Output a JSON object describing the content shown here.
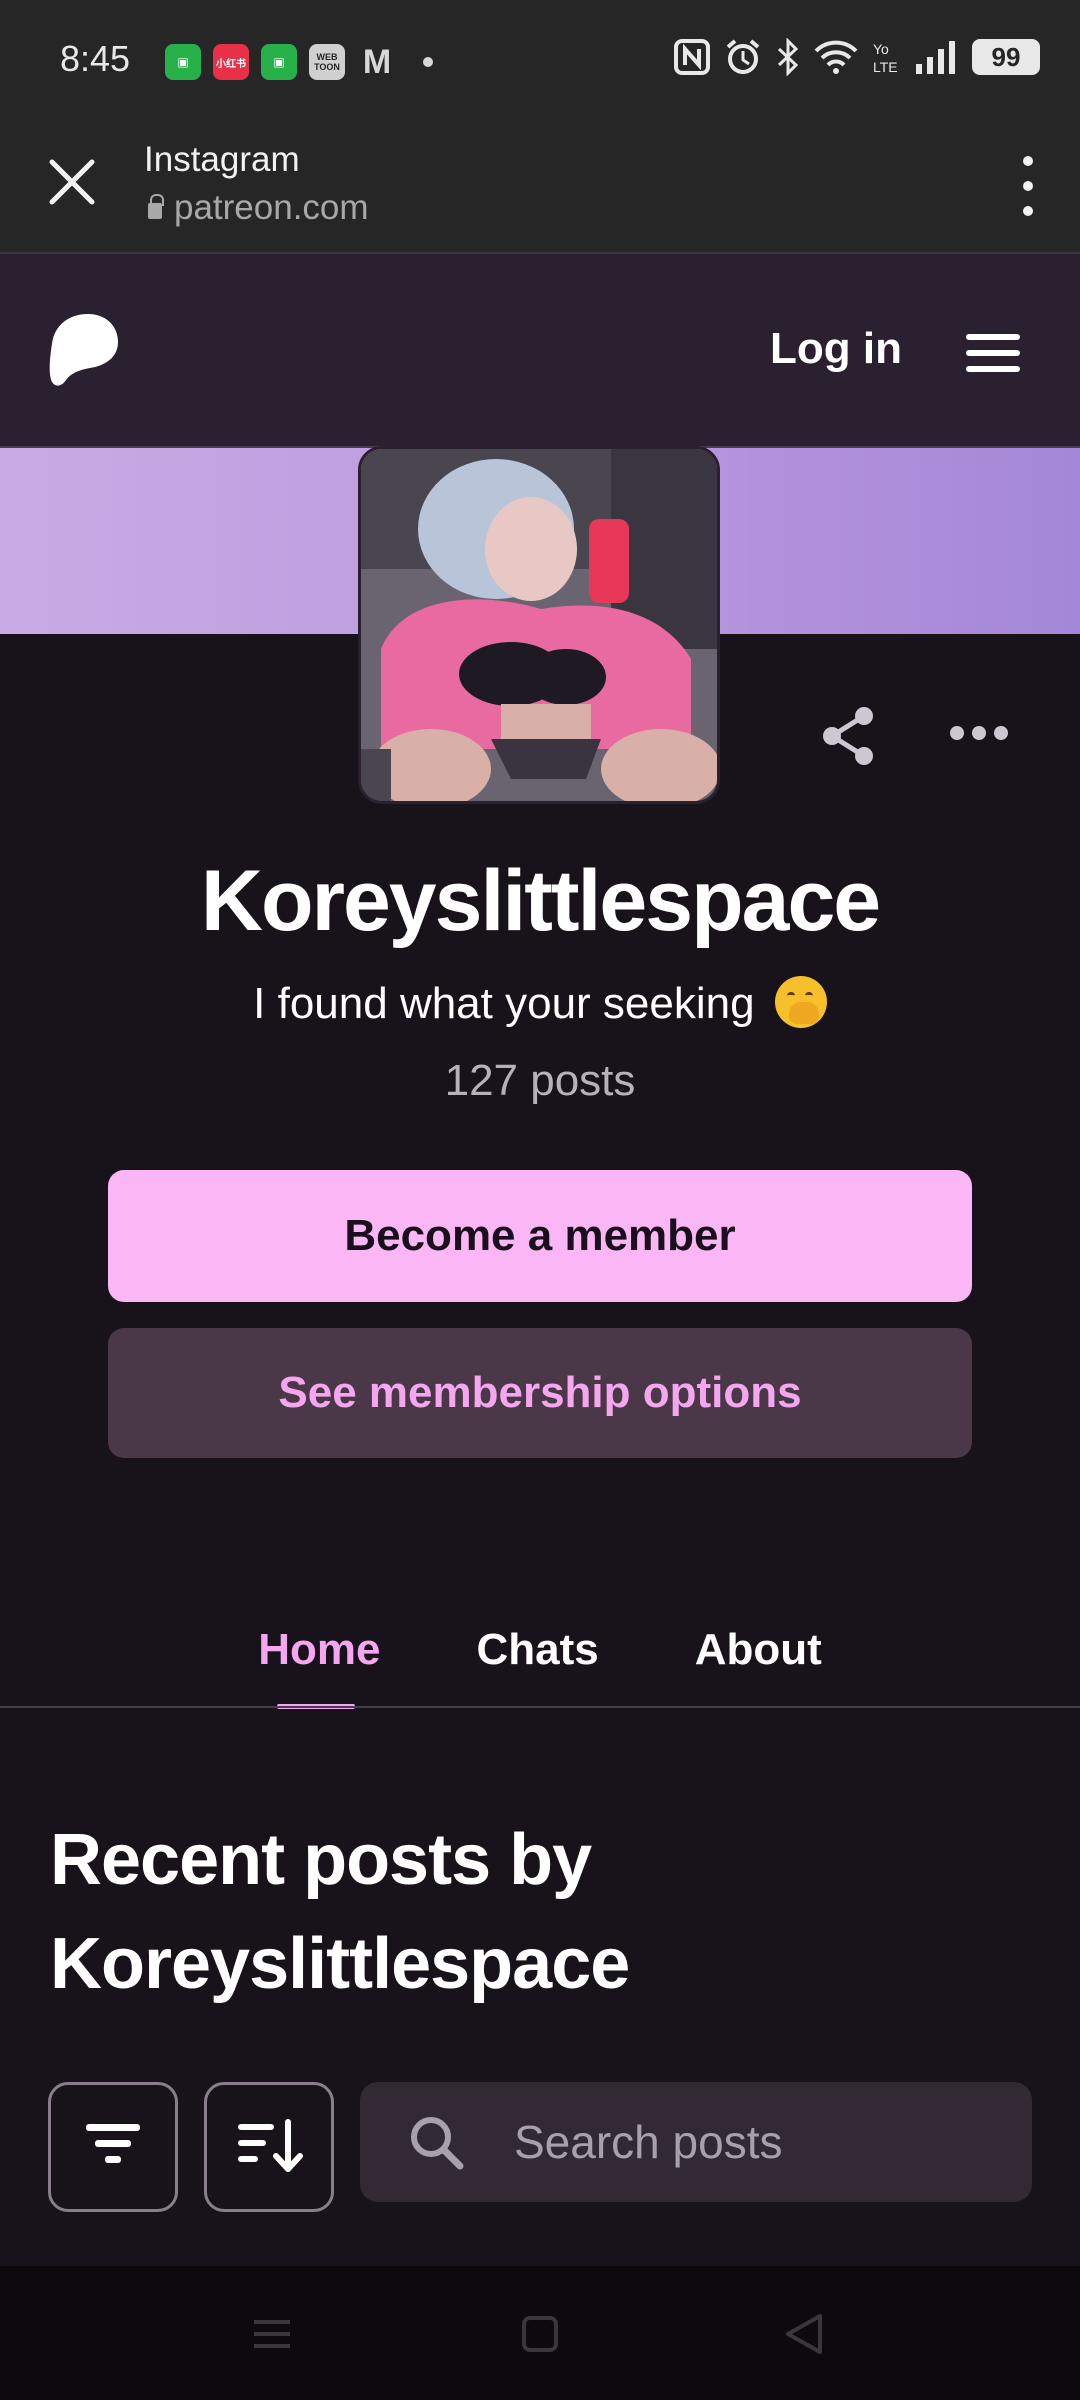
{
  "status_bar": {
    "time": "8:45",
    "notification_icons": [
      "wechat-icon",
      "xiaohongshu-icon",
      "wechat-icon",
      "webtoon-icon",
      "gmail-icon",
      "dot-icon"
    ],
    "small_app_labels": {
      "red": "小红书",
      "webtoon": "WEB TOON"
    },
    "system_icons": [
      "nfc-icon",
      "alarm-icon",
      "bluetooth-icon",
      "wifi-icon",
      "volte-icon",
      "signal-icon"
    ],
    "battery": "99"
  },
  "browser": {
    "title": "Instagram",
    "url": "patreon.com"
  },
  "site_header": {
    "login_label": "Log in"
  },
  "creator": {
    "name": "Koreyslittlespace",
    "tagline": "I found what your seeking",
    "post_count": "127 posts"
  },
  "actions": {
    "become_member": "Become a member",
    "see_options": "See membership options"
  },
  "tabs": [
    {
      "label": "Home",
      "active": true
    },
    {
      "label": "Chats",
      "active": false
    },
    {
      "label": "About",
      "active": false
    }
  ],
  "recent": {
    "heading": "Recent posts by Koreyslittlespace"
  },
  "search": {
    "placeholder": "Search posts"
  },
  "colors": {
    "accent": "#f4a6ef",
    "member_button": "#fbb6f6",
    "background": "#18121a",
    "banner": "#b896de"
  }
}
